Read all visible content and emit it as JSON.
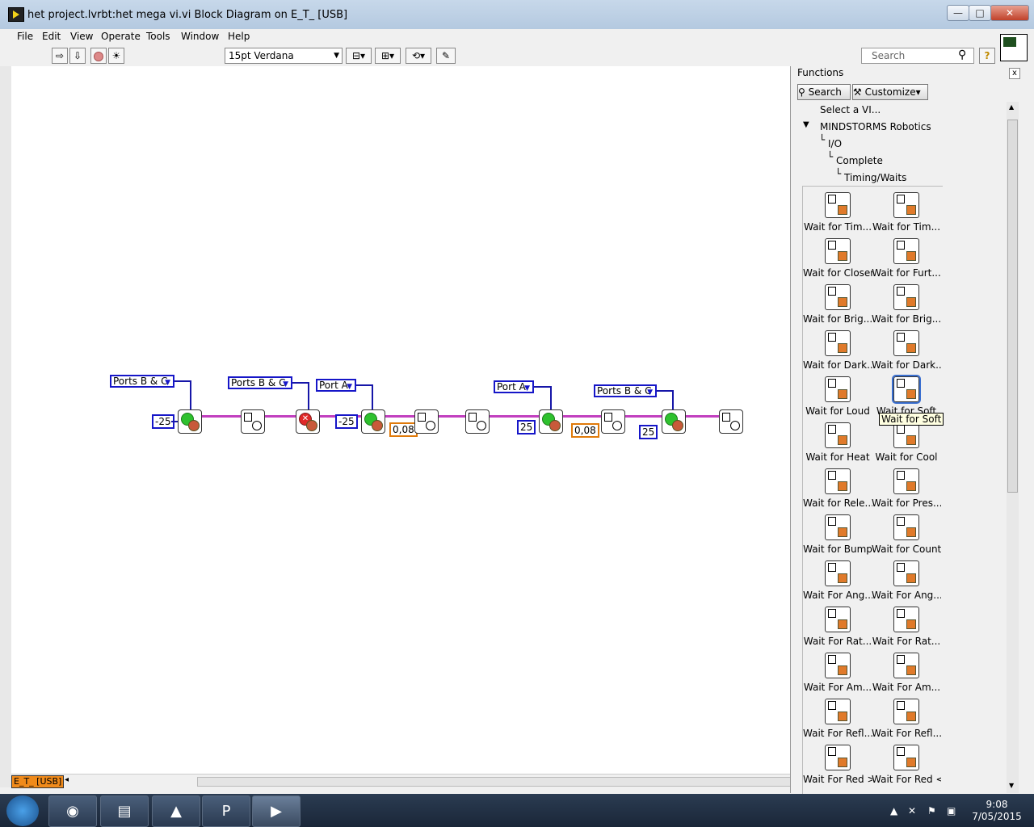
{
  "window": {
    "title": "het project.lvrbt:het mega vi.vi Block Diagram on E_T_ [USB]",
    "controls": {
      "minimize": "—",
      "maximize": "□",
      "close": "✕"
    }
  },
  "menu": [
    "File",
    "Edit",
    "View",
    "Operate",
    "Tools",
    "Window",
    "Help"
  ],
  "toolbar": {
    "font": "15pt Verdana",
    "search_placeholder": "Search",
    "help": "?"
  },
  "diagram": {
    "rings": [
      "Ports B & C",
      "Ports B & C",
      "Port A",
      "Port A",
      "Ports B & C"
    ],
    "constants": [
      "-25",
      "-25",
      "25",
      "25"
    ],
    "doubles": [
      "0,08",
      "0,08"
    ]
  },
  "status": {
    "target": "E_T_ [USB]"
  },
  "palette": {
    "title": "Functions",
    "close": "x",
    "search_button": "Search",
    "customize_button": "Customize",
    "select_vi": "Select a VI...",
    "breadcrumb": [
      "MINDSTORMS Robotics",
      "I/O",
      "Complete",
      "Timing/Waits"
    ],
    "items": [
      {
        "label": "Wait for Tim...",
        "icon": "wait-time-icon"
      },
      {
        "label": "Wait for Tim...",
        "icon": "wait-time-msec-icon"
      },
      {
        "label": "Wait for Closer",
        "icon": "wait-closer-icon"
      },
      {
        "label": "Wait for Furt...",
        "icon": "wait-further-icon"
      },
      {
        "label": "Wait for Brig...",
        "icon": "wait-brighter-icon"
      },
      {
        "label": "Wait for Brig...",
        "icon": "wait-brighter-2-icon"
      },
      {
        "label": "Wait for Dark...",
        "icon": "wait-darker-icon"
      },
      {
        "label": "Wait for Dark...",
        "icon": "wait-darker-2-icon"
      },
      {
        "label": "Wait for Loud",
        "icon": "wait-loud-icon"
      },
      {
        "label": "Wait for Soft",
        "icon": "wait-soft-icon"
      },
      {
        "label": "Wait for Heat",
        "icon": "wait-heat-icon"
      },
      {
        "label": "Wait for Cool",
        "icon": "wait-cool-icon"
      },
      {
        "label": "Wait for Rele...",
        "icon": "wait-release-icon"
      },
      {
        "label": "Wait for Pres...",
        "icon": "wait-press-icon"
      },
      {
        "label": "Wait for Bump",
        "icon": "wait-bump-icon"
      },
      {
        "label": "Wait for Count",
        "icon": "wait-count-icon"
      },
      {
        "label": "Wait For Ang...",
        "icon": "wait-angle-icon"
      },
      {
        "label": "Wait For Ang...",
        "icon": "wait-angle-2-icon"
      },
      {
        "label": "Wait For Rat...",
        "icon": "wait-rate-icon"
      },
      {
        "label": "Wait For Rat...",
        "icon": "wait-rate-2-icon"
      },
      {
        "label": "Wait For Am...",
        "icon": "wait-ambient-icon"
      },
      {
        "label": "Wait For Am...",
        "icon": "wait-ambient-2-icon"
      },
      {
        "label": "Wait For Refl...",
        "icon": "wait-reflected-icon"
      },
      {
        "label": "Wait For Refl...",
        "icon": "wait-reflected-2-icon"
      },
      {
        "label": "Wait For Red >",
        "icon": "wait-red-greater-icon"
      },
      {
        "label": "Wait For Red <",
        "icon": "wait-red-less-icon"
      }
    ],
    "tooltip": "Wait for Soft"
  },
  "taskbar": {
    "apps": [
      "windows-explorer",
      "firefox",
      "file-explorer",
      "vlc",
      "project",
      "labview"
    ],
    "time": "9:08",
    "date": "7/05/2015"
  }
}
